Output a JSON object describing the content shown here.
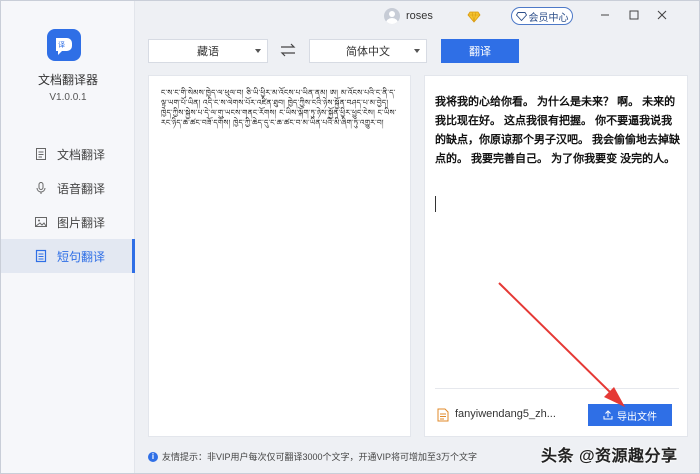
{
  "app": {
    "name": "文档翻译器",
    "version": "V1.0.0.1",
    "brand_color": "#2f6fe6"
  },
  "titlebar": {
    "username": "roses",
    "vip_label": "会员中心"
  },
  "sidebar": {
    "items": [
      {
        "label": "文档翻译",
        "icon": "document-icon",
        "active": false
      },
      {
        "label": "语音翻译",
        "icon": "microphone-icon",
        "active": false
      },
      {
        "label": "图片翻译",
        "icon": "image-icon",
        "active": false
      },
      {
        "label": "短句翻译",
        "icon": "sentence-icon",
        "active": true
      }
    ]
  },
  "toolbar": {
    "source_language": "藏语",
    "target_language": "简体中文",
    "translate_label": "翻译"
  },
  "source": {
    "text": "ང་ས་ང་གི་སེམས་ཁྱེད་ལ་ཕུལ་བ། ཅི་ཡི་ཕྱིར་མ་འོངས་པ་ཡིན་ནམ། ཨ། མ་འོངས་པའི་ང་ནི་ད་ལྟ་ཡག་པོ་ཡིན། འདི་ང་ས་ལེགས་པོར་འཛིན་ཐུབ། ཁྱེད་ཀྱིས་ངའི་ཉེས་སྐྱོན་བཤད་པ་མ་བྱེད། ཁྱེད་ཀྱིས་སྐྱེས་པ་དེ་ལ་གུ་ཡངས་གནང་རོགས། ང་ཡིས་ལྐོག་ཏུ་ཉེས་སྐྱོན་ཕྱིར་ཕྱུང་ངེས། ང་ཡིས་རང་ཉིད་ཆ་ཚང་བཟོ་དགོས། ཁྱེད་ཀྱི་ཆེད་དུ་ང་ཆ་ཚང་བ་མ་ཡིན་པའི་མི་ཞིག་ཏུ་འགྱུར་བ།"
  },
  "target": {
    "text": "我将我的心给你看。 为什么是未来？ 啊。 未来的我比现在好。 这点我很有把握。 你不要逼我说我的缺点，你原谅那个男子汉吧。 我会偷偷地去掉缺点的。 我要完善自己。 为了你我要变 没完的人。",
    "file_name": "fanyiwendang5_zh...",
    "export_label": "导出文件"
  },
  "footer": {
    "tip": "友情提示：非VIP用户每次仅可翻译3000个文字，开通VIP将可增加至3万个文字"
  },
  "watermark": "头条 @资源趣分享"
}
